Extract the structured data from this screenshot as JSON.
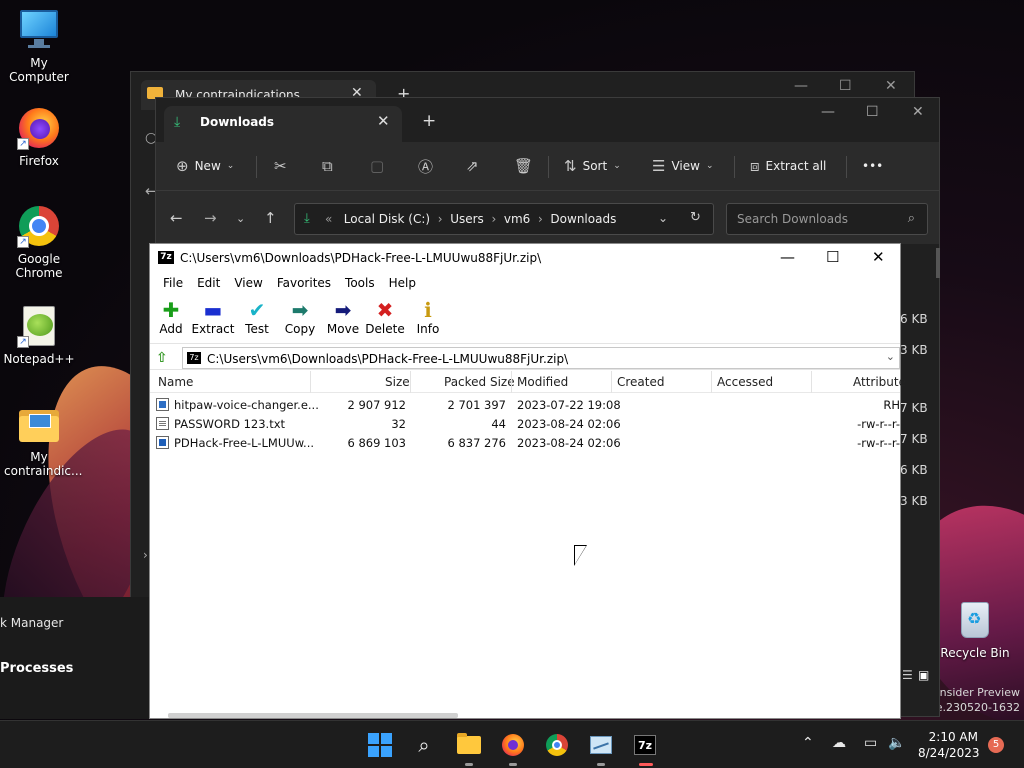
{
  "desktop": {
    "icons": [
      {
        "label": "My Computer",
        "icon": "monitor-icon"
      },
      {
        "label": "Firefox",
        "icon": "firefox-icon"
      },
      {
        "label": "Google Chrome",
        "icon": "chrome-icon"
      },
      {
        "label": "Notepad++",
        "icon": "notepadpp-icon"
      },
      {
        "label": "My contraindic...",
        "icon": "folder-icon"
      }
    ],
    "recycle_bin": "Recycle Bin",
    "watermark_line1": "11 Pro Insider Preview",
    "watermark_line2": "zn_release.230520-1632"
  },
  "back_window": {
    "tab_label": "My contraindications",
    "task_manager_label": "k Manager",
    "processes_label": "Processes"
  },
  "downloads_window": {
    "tab_label": "Downloads",
    "toolbar": {
      "new_label": "New",
      "sort_label": "Sort",
      "view_label": "View",
      "extract_all_label": "Extract all",
      "more_label": "•••"
    },
    "address": {
      "prefix": "«",
      "crumbs": [
        "Local Disk (C:)",
        "Users",
        "vm6",
        "Downloads"
      ]
    },
    "search_placeholder": "Search Downloads",
    "visible_sizes": [
      "6 KB",
      "3 KB",
      "7 KB",
      "7 KB",
      "6 KB",
      "3 KB"
    ]
  },
  "sevenzip": {
    "title": "C:\\Users\\vm6\\Downloads\\PDHack-Free-L-LMUUwu88FjUr.zip\\",
    "menu": [
      "File",
      "Edit",
      "View",
      "Favorites",
      "Tools",
      "Help"
    ],
    "toolbar": [
      {
        "label": "Add",
        "icon": "add-icon",
        "glyph": "✚",
        "color": "#1a9e1a"
      },
      {
        "label": "Extract",
        "icon": "extract-icon",
        "glyph": "▬",
        "color": "#1a2fd0"
      },
      {
        "label": "Test",
        "icon": "test-icon",
        "glyph": "✔",
        "color": "#19b3c8"
      },
      {
        "label": "Copy",
        "icon": "copy-icon",
        "glyph": "➡",
        "color": "#1d7a6c"
      },
      {
        "label": "Move",
        "icon": "move-icon",
        "glyph": "➡",
        "color": "#141b7a"
      },
      {
        "label": "Delete",
        "icon": "delete-icon",
        "glyph": "✖",
        "color": "#d42020"
      },
      {
        "label": "Info",
        "icon": "info-icon",
        "glyph": "ℹ",
        "color": "#c89a10"
      }
    ],
    "path": "C:\\Users\\vm6\\Downloads\\PDHack-Free-L-LMUUwu88FjUr.zip\\",
    "columns": [
      "Name",
      "Size",
      "Packed Size",
      "Modified",
      "Created",
      "Accessed",
      "Attribute"
    ],
    "rows": [
      {
        "name": "hitpaw-voice-changer.e...",
        "type": "exe",
        "size": "2 907 912",
        "packed": "2 701 397",
        "modified": "2023-07-22 19:08",
        "created": "",
        "accessed": "",
        "attr": "RH"
      },
      {
        "name": "PASSWORD 123.txt",
        "type": "txt",
        "size": "32",
        "packed": "44",
        "modified": "2023-08-24 02:06",
        "created": "",
        "accessed": "",
        "attr": "-rw-r--r-"
      },
      {
        "name": "PDHack-Free-L-LMUUw...",
        "type": "zip",
        "size": "6 869 103",
        "packed": "6 837 276",
        "modified": "2023-08-24 02:06",
        "created": "",
        "accessed": "",
        "attr": "-rw-r--r-"
      }
    ]
  },
  "taskbar": {
    "time": "2:10 AM",
    "date": "8/24/2023",
    "notifications": "5"
  }
}
